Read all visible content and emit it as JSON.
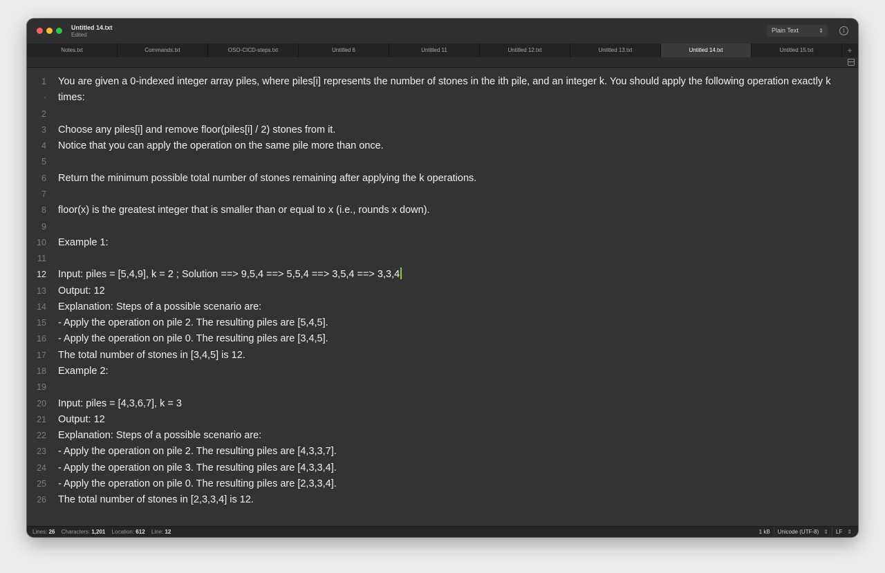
{
  "window": {
    "title": "Untitled 14.txt",
    "subtitle": "Edited",
    "syntax_mode": "Plain Text",
    "info_icon": "i"
  },
  "tabs": [
    {
      "label": "Notes.txt",
      "active": false
    },
    {
      "label": "Commands.txt",
      "active": false
    },
    {
      "label": "OSO-CICD-steps.txt",
      "active": false
    },
    {
      "label": "Untitled 6",
      "active": false
    },
    {
      "label": "Untitled 11",
      "active": false
    },
    {
      "label": "Untitled 12.txt",
      "active": false
    },
    {
      "label": "Untitled 13.txt",
      "active": false
    },
    {
      "label": "Untitled 14.txt",
      "active": true
    },
    {
      "label": "Untitled 15.txt",
      "active": false
    }
  ],
  "tab_add_label": "+",
  "editor": {
    "current_line": 12,
    "rows": [
      {
        "n": "1",
        "text": "You are given a 0-indexed integer array piles, where piles[i] represents the number of stones in the ith pile, and an integer k. You should apply the following operation exactly k"
      },
      {
        "n": "·",
        "text": "times:"
      },
      {
        "n": "2",
        "text": ""
      },
      {
        "n": "3",
        "text": "Choose any piles[i] and remove floor(piles[i] / 2) stones from it."
      },
      {
        "n": "4",
        "text": "Notice that you can apply the operation on the same pile more than once."
      },
      {
        "n": "5",
        "text": ""
      },
      {
        "n": "6",
        "text": "Return the minimum possible total number of stones remaining after applying the k operations."
      },
      {
        "n": "7",
        "text": ""
      },
      {
        "n": "8",
        "text": "floor(x) is the greatest integer that is smaller than or equal to x (i.e., rounds x down)."
      },
      {
        "n": "9",
        "text": ""
      },
      {
        "n": "10",
        "text": "Example 1:"
      },
      {
        "n": "11",
        "text": ""
      },
      {
        "n": "12",
        "text": "Input: piles = [5,4,9], k = 2 ; Solution ==> 9,5,4 ==> 5,5,4 ==> 3,5,4 ==> 3,3,4"
      },
      {
        "n": "13",
        "text": "Output: 12"
      },
      {
        "n": "14",
        "text": "Explanation: Steps of a possible scenario are:"
      },
      {
        "n": "15",
        "text": "- Apply the operation on pile 2. The resulting piles are [5,4,5]."
      },
      {
        "n": "16",
        "text": "- Apply the operation on pile 0. The resulting piles are [3,4,5]."
      },
      {
        "n": "17",
        "text": "The total number of stones in [3,4,5] is 12."
      },
      {
        "n": "18",
        "text": "Example 2:"
      },
      {
        "n": "19",
        "text": ""
      },
      {
        "n": "20",
        "text": "Input: piles = [4,3,6,7], k = 3"
      },
      {
        "n": "21",
        "text": "Output: 12"
      },
      {
        "n": "22",
        "text": "Explanation: Steps of a possible scenario are:"
      },
      {
        "n": "23",
        "text": "- Apply the operation on pile 2. The resulting piles are [4,3,3,7]."
      },
      {
        "n": "24",
        "text": "- Apply the operation on pile 3. The resulting piles are [4,3,3,4]."
      },
      {
        "n": "25",
        "text": "- Apply the operation on pile 0. The resulting piles are [2,3,3,4]."
      },
      {
        "n": "26",
        "text": "The total number of stones in [2,3,3,4] is 12."
      }
    ]
  },
  "status": {
    "lines_label": "Lines:",
    "lines_value": "26",
    "chars_label": "Characters:",
    "chars_value": "1,201",
    "location_label": "Location:",
    "location_value": "612",
    "line_label": "Line:",
    "line_value": "12",
    "size": "1 kB",
    "encoding": "Unicode (UTF-8)",
    "line_ending": "LF"
  },
  "colors": {
    "window_bg": "#333333",
    "cursor": "#7fd03a",
    "close": "#fe5f57",
    "minimize": "#febc2e",
    "maximize": "#28c840"
  }
}
